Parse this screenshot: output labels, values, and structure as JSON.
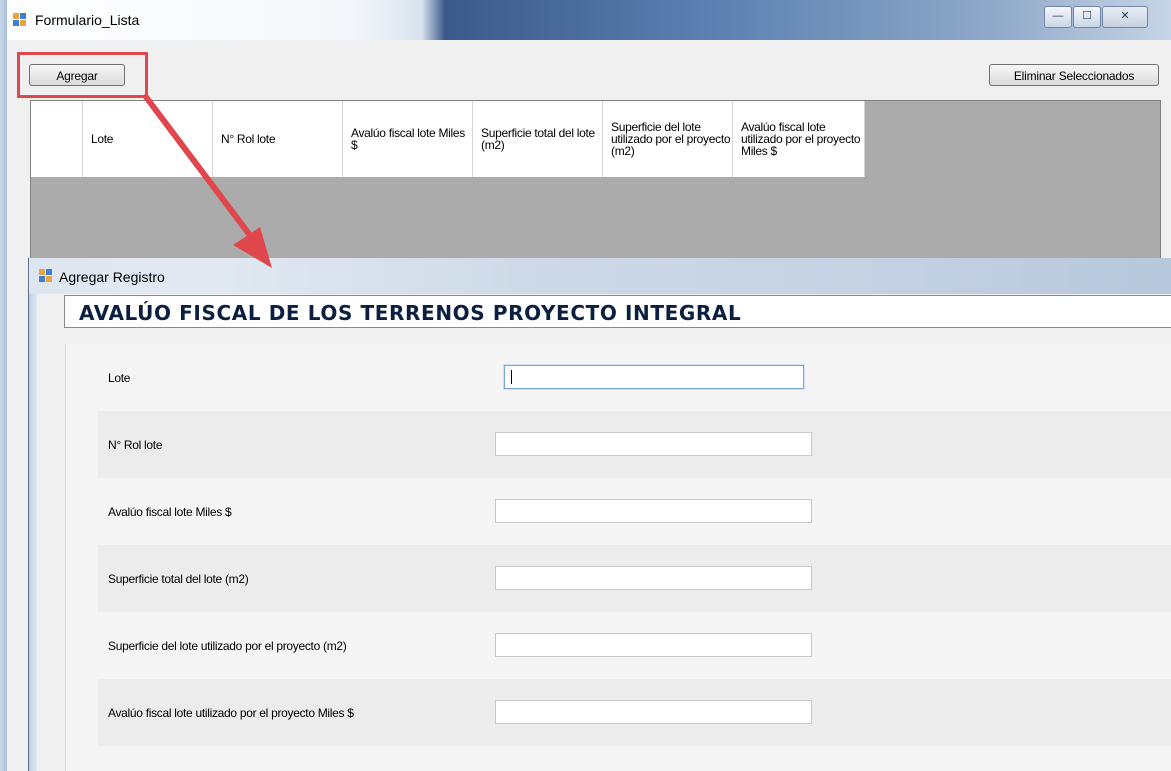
{
  "main_window": {
    "title": "Formulario_Lista",
    "controls": {
      "minimize": "—",
      "maximize": "☐",
      "close": "✕"
    },
    "add_button": "Agregar",
    "delete_selected_button": "Eliminar Seleccionados",
    "grid_columns": [
      "Lote",
      "N° Rol lote",
      "Avalúo fiscal lote Miles $",
      "Superficie total del lote (m2)",
      "Superficie del lote utilizado por el proyecto (m2)",
      "Avalúo fiscal lote utilizado por el proyecto Miles $"
    ]
  },
  "dialog": {
    "title": "Agregar Registro",
    "heading": "AVALÚO FISCAL DE LOS TERRENOS PROYECTO INTEGRAL",
    "fields": [
      {
        "label": "Lote",
        "value": ""
      },
      {
        "label": "N° Rol lote",
        "value": ""
      },
      {
        "label": "Avalúo fiscal lote Miles $",
        "value": ""
      },
      {
        "label": "Superficie total del lote (m2)",
        "value": ""
      },
      {
        "label": "Superficie del lote utilizado por el proyecto (m2)",
        "value": ""
      },
      {
        "label": "Avalúo fiscal lote utilizado por el proyecto Miles $",
        "value": ""
      }
    ]
  },
  "colors": {
    "highlight": "#e0474c",
    "heading_text": "#0c1f40"
  }
}
